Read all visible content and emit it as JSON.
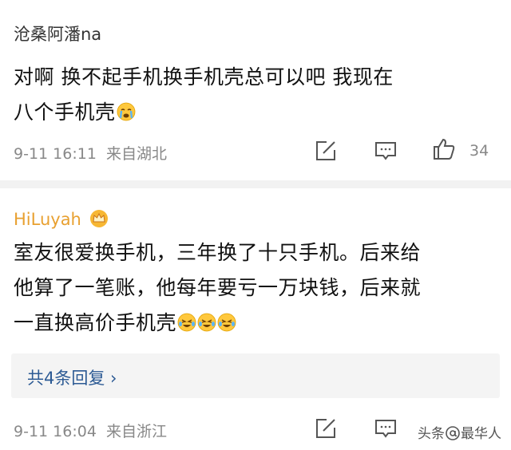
{
  "comments": [
    {
      "username": "沧桑阿潘na",
      "lines": [
        "对啊  换不起手机换手机壳总可以吧  我现在",
        "八个手机壳"
      ],
      "emoji": "crying-emoji",
      "date": "9-11 16:11",
      "location": "来自湖北",
      "like_count": "34"
    },
    {
      "username": "HiLuyah",
      "badge": "crown-badge",
      "lines": [
        "室友很爱换手机，三年换了十只手机。后来给",
        "他算了一笔账，他每年要亏一万块钱，后来就",
        "一直换高价手机壳"
      ],
      "emoji": "laughing-crying-emoji",
      "date": "9-11 16:04",
      "location": "来自浙江",
      "replies_label": "共4条回复 ›"
    }
  ],
  "watermark": {
    "left": "头条",
    "right": "最华人"
  },
  "colors": {
    "username_vip": "#e8a030",
    "link": "#2c5a94",
    "meta": "#888888"
  }
}
